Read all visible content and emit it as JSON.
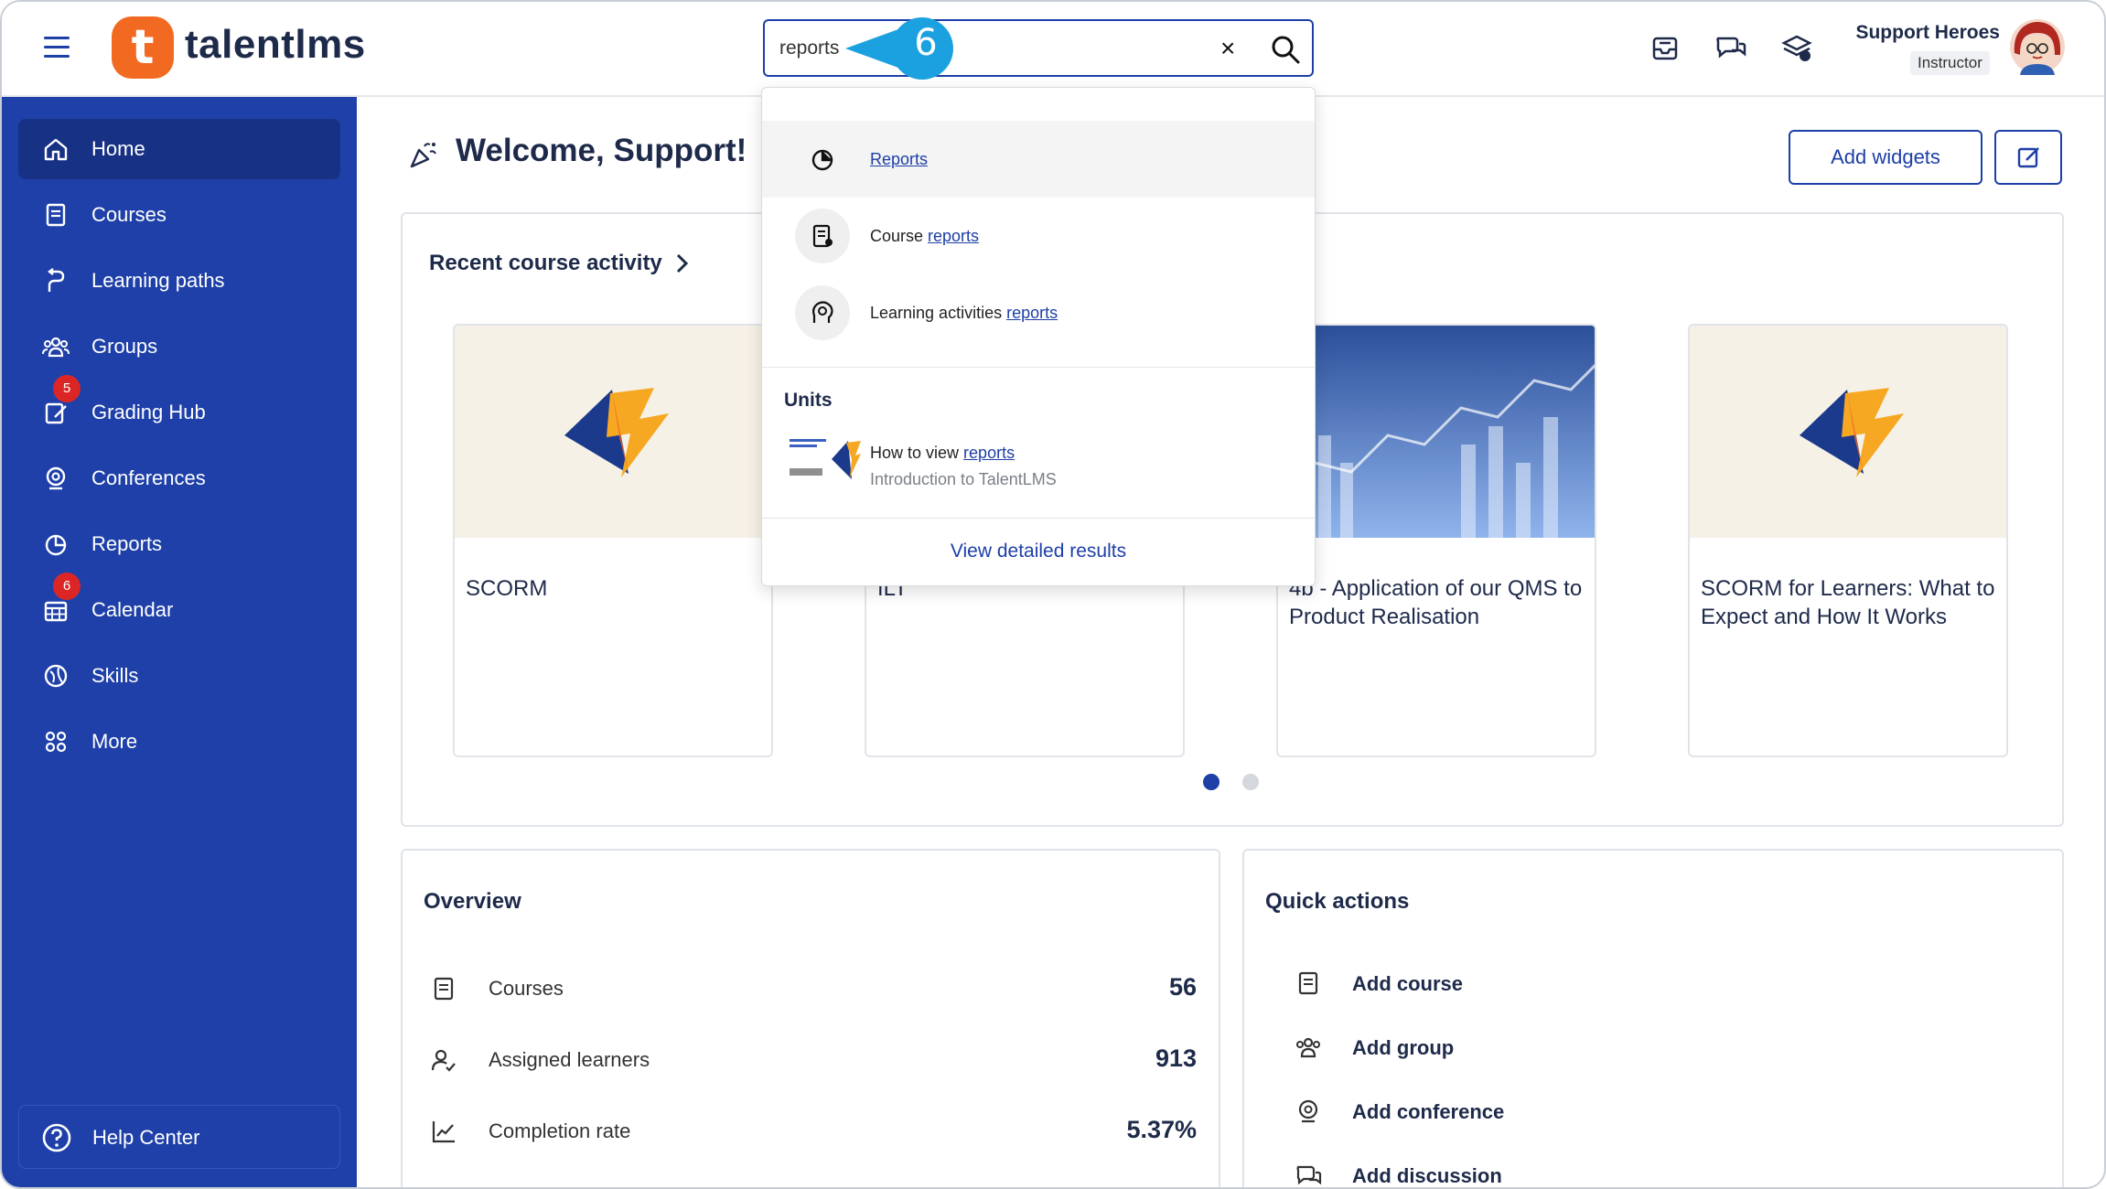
{
  "app": {
    "logo_text": "talentlms",
    "logo_letter": "t"
  },
  "search": {
    "value": "reports",
    "clear_label": "×"
  },
  "callout": {
    "step": "6"
  },
  "user": {
    "name": "Support Heroes",
    "role": "Instructor"
  },
  "sidebar": {
    "items": [
      {
        "label": "Home",
        "icon": "home-icon"
      },
      {
        "label": "Courses",
        "icon": "courses-icon"
      },
      {
        "label": "Learning paths",
        "icon": "learning-paths-icon"
      },
      {
        "label": "Groups",
        "icon": "groups-icon"
      },
      {
        "label": "Grading Hub",
        "icon": "grading-hub-icon",
        "badge": "5"
      },
      {
        "label": "Conferences",
        "icon": "conferences-icon"
      },
      {
        "label": "Reports",
        "icon": "reports-icon"
      },
      {
        "label": "Calendar",
        "icon": "calendar-icon",
        "badge": "6"
      },
      {
        "label": "Skills",
        "icon": "skills-icon"
      },
      {
        "label": "More",
        "icon": "more-icon"
      }
    ],
    "help_center": "Help Center"
  },
  "main": {
    "welcome": "Welcome, Support!",
    "add_widgets": "Add widgets",
    "recent_activity": {
      "title": "Recent course activity",
      "courses": [
        {
          "title": "SCORM"
        },
        {
          "title": "ILT"
        },
        {
          "title": "4b - Application of our QMS to Product Realisation"
        },
        {
          "title": "SCORM for Learners: What to Expect and How It Works"
        }
      ]
    },
    "overview": {
      "title": "Overview",
      "rows": [
        {
          "label": "Courses",
          "value": "56"
        },
        {
          "label": "Assigned learners",
          "value": "913"
        },
        {
          "label": "Completion rate",
          "value": "5.37%"
        }
      ]
    },
    "quick_actions": {
      "title": "Quick actions",
      "items": [
        {
          "label": "Add course"
        },
        {
          "label": "Add group"
        },
        {
          "label": "Add conference"
        },
        {
          "label": "Add discussion"
        }
      ]
    }
  },
  "dropdown": {
    "results": [
      {
        "prefix": "",
        "link": "Reports"
      },
      {
        "prefix": "Course ",
        "link": "reports"
      },
      {
        "prefix": "Learning activities ",
        "link": "reports"
      }
    ],
    "units_header": "Units",
    "unit": {
      "title_prefix": "How to view ",
      "title_link": "reports",
      "subtitle": "Introduction to TalentLMS"
    },
    "view_all": "View detailed results"
  },
  "colors": {
    "brand_blue": "#1e40a8",
    "accent_orange": "#f26a21",
    "callout_blue": "#1ca1e0",
    "badge_red": "#dc2626"
  }
}
